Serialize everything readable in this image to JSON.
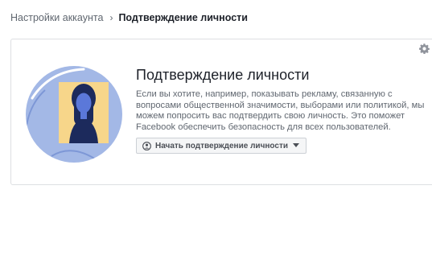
{
  "breadcrumb": {
    "parent": "Настройки аккаунта",
    "separator": "›",
    "current": "Подтверждение личности"
  },
  "card": {
    "title": "Подтверждение личности",
    "description": "Если вы хотите, например, показывать рекламу, связанную с вопросами общественной значимости, выборами или политикой, мы можем попросить вас подтвердить свою личность. Это поможет Facebook обеспечить безопасность для всех пользователей.",
    "start_button_label": "Начать подтверждение личности",
    "start_button_icon": "id-badge-icon",
    "settings_icon": "gear-icon"
  },
  "colors": {
    "illustration_bg": "#a3b8e6",
    "illustration_frame": "#f7d68a",
    "illustration_figure": "#1c2a5c",
    "illustration_face": "#5b78d9"
  }
}
